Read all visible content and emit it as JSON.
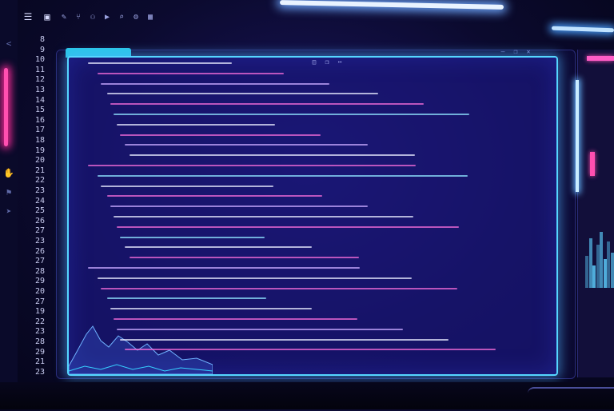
{
  "colors": {
    "accent_cyan": "#55d6ff",
    "accent_pink": "#ff4fb0",
    "background": "#0b0a2e",
    "panel": "#1e1a8c"
  },
  "toolbar": {
    "items": [
      {
        "icon": "menu-icon",
        "glyph": "☰"
      },
      {
        "icon": "file-icon",
        "glyph": "▣"
      },
      {
        "icon": "edit-icon",
        "glyph": "✎"
      },
      {
        "icon": "git-icon",
        "glyph": "⑂"
      },
      {
        "icon": "debug-icon",
        "glyph": "⚇"
      },
      {
        "icon": "run-icon",
        "glyph": "▶"
      },
      {
        "icon": "search-icon",
        "glyph": "⌕"
      },
      {
        "icon": "settings-icon",
        "glyph": "⚙"
      },
      {
        "icon": "extensions-icon",
        "glyph": "▦"
      }
    ]
  },
  "editor": {
    "line_numbers": [
      "8",
      "9",
      "10",
      "11",
      "12",
      "13",
      "14",
      "15",
      "16",
      "17",
      "18",
      "19",
      "20",
      "21",
      "22",
      "23",
      "24",
      "25",
      "26",
      "27",
      "23",
      "26",
      "27",
      "28",
      "29",
      "20",
      "27",
      "19",
      "22",
      "23",
      "28",
      "29",
      "21",
      "23"
    ],
    "code_lines": []
  },
  "panel_toolbar": {
    "items": [
      {
        "icon": "split-icon",
        "glyph": "◫"
      },
      {
        "icon": "copy-icon",
        "glyph": "❐"
      },
      {
        "icon": "more-icon",
        "glyph": "⋯"
      }
    ]
  },
  "right_toolbar": {
    "items": [
      {
        "icon": "minimize-icon",
        "glyph": "—"
      },
      {
        "icon": "restore-icon",
        "glyph": "❐"
      },
      {
        "icon": "close-icon",
        "glyph": "✕"
      }
    ]
  }
}
